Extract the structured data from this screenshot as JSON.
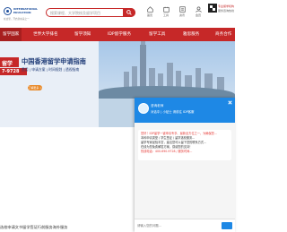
{
  "header": {
    "logo_line1": "INTERNATIONAL",
    "logo_line2": "EDUCATION",
    "logo_sub": "在这里，开启新未来之一",
    "search_placeholder": "搜索课程、大学院校及留学项目",
    "tools": [
      {
        "label": "首页",
        "icon": "home-icon"
      },
      {
        "label": "工具",
        "icon": "tool-icon"
      },
      {
        "label": "资讯",
        "icon": "news-icon"
      },
      {
        "label": "会员",
        "icon": "user-icon"
      }
    ],
    "qr_text1": "专业留学机构",
    "qr_text2": "服务咨询热线"
  },
  "nav": {
    "items": [
      "留学国家",
      "世界大学排名",
      "留学须知",
      "IDP留学服务",
      "留学工具",
      "雅思服务",
      "商务合作"
    ],
    "active_index": 0
  },
  "banner": {
    "badge": "留学",
    "phone": "7-9728",
    "title": "中国香港留学申请指南",
    "subtitle": "费用 | 申请方案 | 时间规划 | 透视指南",
    "button": "了解更多 >"
  },
  "caption": "选校申请文书留学签证行前服务海外服务",
  "chat": {
    "name": "咨询老师",
    "status": "对话中 | 小贴士 请前往 IDP客服",
    "message_lines": [
      "您好！IDP留学一键申请专享、最新全方位之一，为确保您...",
      "本科申请类型 / 学生签证 / 留学选校服务...",
      "留学专家经验丰富，建议您可以留下您的联系方式...",
      "在线为您免费解答方案，感谢您的支持！",
      "热线电话：400-690-9728 / 服务时间..."
    ],
    "input_placeholder": "请输入您的问题..."
  }
}
